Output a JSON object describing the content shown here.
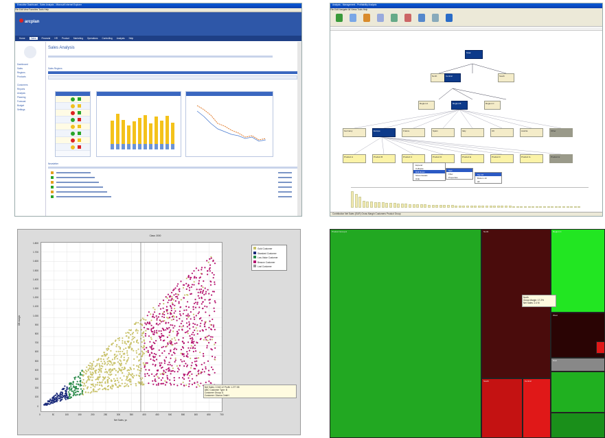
{
  "q1": {
    "title": "Executive Dashboard - Sales Analysis - Microsoft Internet Explorer",
    "menu": "File  Edit  View  Favorites  Tools  Help",
    "logo": "arcplan",
    "nav": [
      "Home",
      "Sales",
      "Financial",
      "HR",
      "Product",
      "Marketing",
      "Operations",
      "Controlling",
      "Analysis",
      "Help"
    ],
    "page_title": "Sales Analysis",
    "section": "Sales Regions",
    "news_header": "Newsletter",
    "sidebar_items": [
      "Dashboard",
      "Sales",
      "Regions",
      "Products",
      "Customers",
      "Reports",
      "Analysis",
      "Planning",
      "Forecast",
      "Budget",
      "Settings"
    ],
    "bar_values": [
      0.6,
      0.75,
      0.62,
      0.5,
      0.58,
      0.66,
      0.72,
      0.54,
      0.68,
      0.6,
      0.7,
      0.56
    ]
  },
  "q2": {
    "title": "Analysis - Management - Profitability Analysis",
    "menu": "File  Edit  Navigate  All Views  Tools  Help",
    "root": "Total",
    "level1": [
      "North",
      "Central",
      "South"
    ],
    "level2": [
      "Region A",
      "Region B",
      "Region C"
    ],
    "level3": [
      "Germany",
      "Europe",
      "France",
      "Spain",
      "Italy",
      "UK",
      "Austria",
      "Other"
    ],
    "level4": [
      "Product A",
      "Product B",
      "Product C",
      "Product D",
      "Product E",
      "Product F",
      "Product G",
      "Product H"
    ],
    "menu1": [
      "Expand",
      "Collapse",
      "Drill Down",
      "Show Details",
      "Hide"
    ],
    "menu2": [
      "Sort",
      "Filter",
      "Properties"
    ],
    "menu3": [
      "Top 10",
      "Bottom 10",
      "All"
    ],
    "status": "Contribution   Net Sales (EUR)   Gross Margin   Customers   Product Group"
  },
  "q3": {
    "chart_title": "Class: 3000",
    "ylabel": "DB margin",
    "xlabel": "Net Sales, ys",
    "legend": [
      "Gold Customer",
      "Standard Customer",
      "Low-Value Customer",
      "Beacon Customer",
      "Lost Customer"
    ],
    "tooltip": [
      "Net Sales: 2.342.12  Profit: 1.277.55",
      "ABC Customer Type: B",
      "Customer Group: A",
      "Customer: Dlonos GmbH"
    ],
    "yticks": [
      "1.800",
      "1.700",
      "1.600",
      "1.500",
      "1.400",
      "1.300",
      "1.200",
      "1.100",
      "1.000",
      "900",
      "800",
      "700",
      "600",
      "500",
      "400",
      "300",
      "200",
      "100",
      "0"
    ],
    "xticks": [
      "0",
      "50",
      "100",
      "150",
      "200",
      "250",
      "300",
      "350",
      "400",
      "450",
      "500",
      "550",
      "600",
      "650",
      "700"
    ]
  },
  "q4": {
    "tiles": [
      "Product Group A",
      "North",
      "Region C",
      "West",
      "East",
      "South",
      "Central"
    ],
    "tooltip": [
      "North",
      "Gross Margin: 17.2%",
      "Net Sales: 2.4 M"
    ]
  }
}
